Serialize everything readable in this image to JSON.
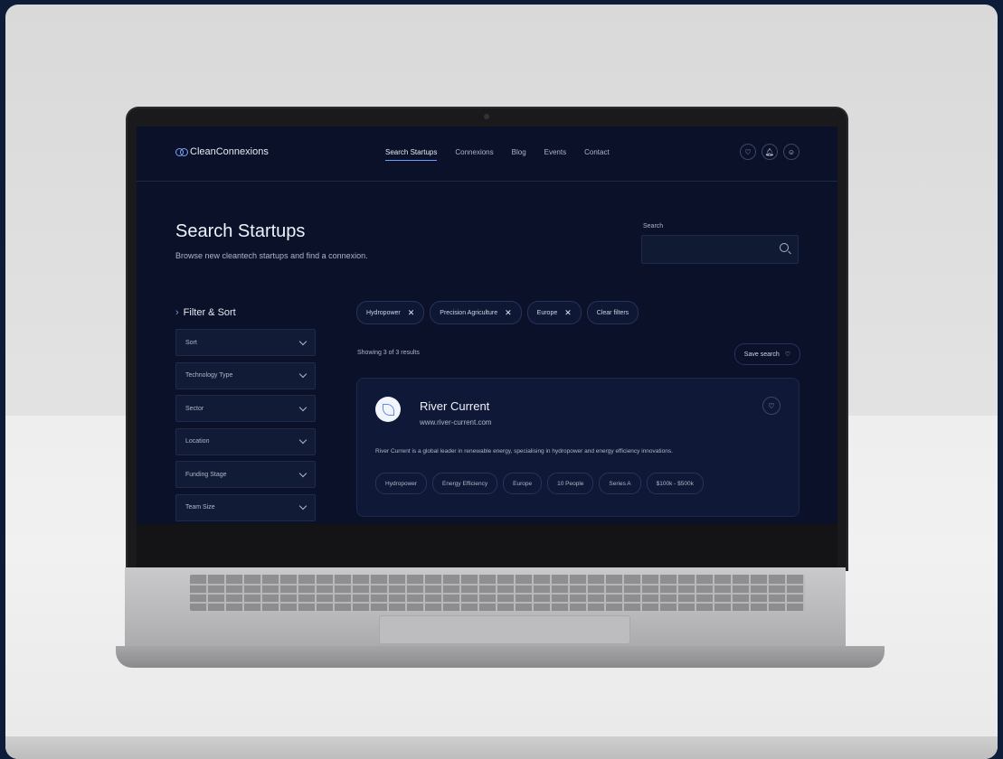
{
  "nav": {
    "logo": "CleanConnexions",
    "links": [
      "Search Startups",
      "Connexions",
      "Blog",
      "Events",
      "Contact"
    ],
    "active_link": "Search Startups",
    "icons": [
      "heart-icon",
      "bell-icon",
      "user-icon"
    ]
  },
  "header": {
    "title": "Search Startups",
    "subtitle": "Browse new cleantech startups and find a connexion.",
    "search_label": "Search",
    "search_value": ""
  },
  "filters": {
    "heading": "Filter & Sort",
    "items": [
      "Sort",
      "Technology Type",
      "Sector",
      "Location",
      "Funding Stage",
      "Team Size"
    ]
  },
  "active_filters": {
    "chips": [
      "Hydropower",
      "Precision Agriculture",
      "Europe"
    ],
    "clear_label": "Clear filters"
  },
  "results": {
    "count_text": "Showing 3 of 3 results",
    "save_label": "Save search"
  },
  "card": {
    "name": "River Current",
    "url": "www.river-current.com",
    "description": "River Current is a global leader in renewable energy, specialising in hydropower and energy efficiency innovations.",
    "tags": [
      "Hydropower",
      "Energy Efficiency",
      "Europe",
      "10 People",
      "Series A",
      "$100k - $500k"
    ]
  },
  "colors": {
    "screen_bg": "#0a1128",
    "accent": "#6e9bff",
    "page_bg": "#0d1c38"
  }
}
